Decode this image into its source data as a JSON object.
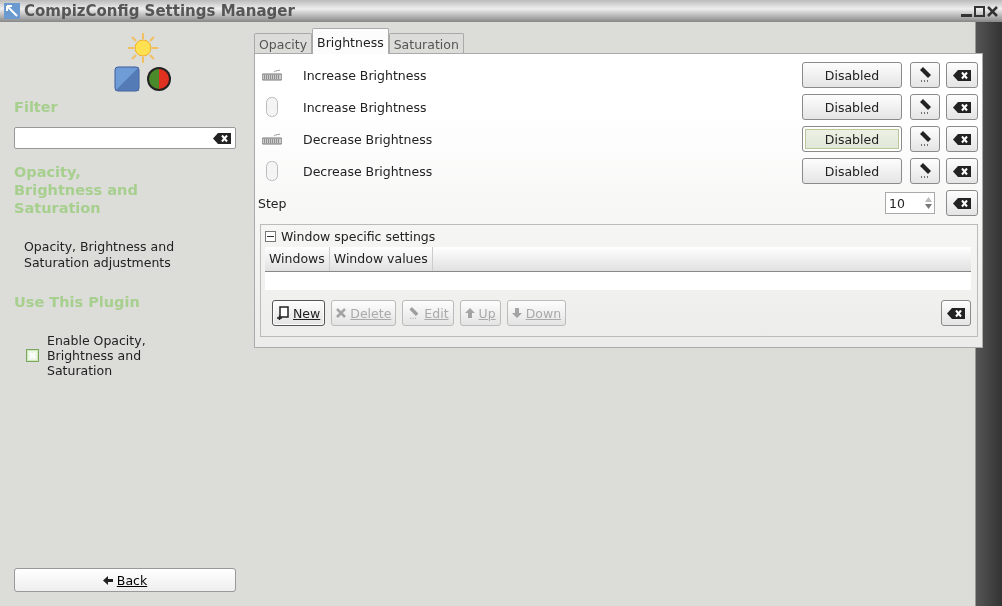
{
  "window": {
    "title": "CompizConfig Settings Manager"
  },
  "sidebar": {
    "filter_heading": "Filter",
    "plugin_heading": "Opacity, Brightness and Saturation",
    "description": "Opacity, Brightness and Saturation adjustments",
    "use_heading": "Use This Plugin",
    "enable": {
      "label": "Enable Opacity, Brightness and Saturation",
      "checked": true
    },
    "back": "Back"
  },
  "tabs": [
    {
      "label": "Opacity",
      "selected": false
    },
    {
      "label": "Brightness",
      "selected": true
    },
    {
      "label": "Saturation",
      "selected": false
    }
  ],
  "bindings": [
    {
      "kind": "keyboard",
      "label": "Increase Brightness",
      "value": "Disabled",
      "focused": false
    },
    {
      "kind": "mouse",
      "label": "Increase Brightness",
      "value": "Disabled",
      "focused": false
    },
    {
      "kind": "keyboard",
      "label": "Decrease Brightness",
      "value": "Disabled",
      "focused": true
    },
    {
      "kind": "mouse",
      "label": "Decrease Brightness",
      "value": "Disabled",
      "focused": false
    }
  ],
  "step": {
    "label": "Step",
    "value": "10"
  },
  "window_settings": {
    "title": "Window specific settings",
    "expanded": true,
    "columns": [
      "Windows",
      "Window values"
    ],
    "buttons": [
      {
        "kind": "new",
        "label": "New",
        "disabled": false
      },
      {
        "kind": "delete",
        "label": "Delete",
        "disabled": true
      },
      {
        "kind": "edit",
        "label": "Edit",
        "disabled": true
      },
      {
        "kind": "up",
        "label": "Up",
        "disabled": true
      },
      {
        "kind": "down",
        "label": "Down",
        "disabled": true
      }
    ]
  }
}
